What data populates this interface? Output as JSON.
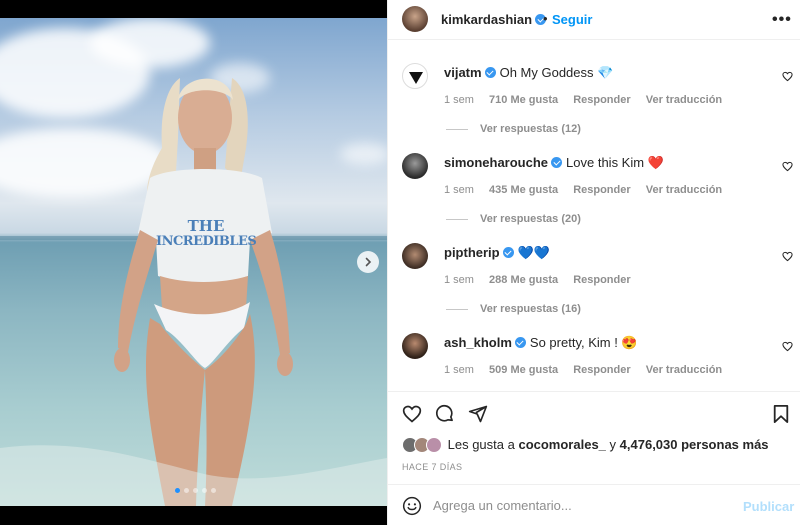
{
  "post": {
    "author": "kimkardashian",
    "separator": "•",
    "follow_label": "Seguir",
    "more_label": "•••",
    "media": {
      "shirt_text_line1": "THE",
      "shirt_text_line2": "INCREDIBLES",
      "slide_count": 5,
      "active_slide": 1
    }
  },
  "comments": [
    {
      "user": "vijatm",
      "text": "Oh My Goddess 💎",
      "time": "1 sem",
      "likes": "710 Me gusta",
      "reply": "Responder",
      "translate": "Ver traducción",
      "replies": "Ver respuestas (12)"
    },
    {
      "user": "simoneharouche",
      "text": "Love this Kim ❤️",
      "time": "1 sem",
      "likes": "435 Me gusta",
      "reply": "Responder",
      "translate": "Ver traducción",
      "replies": "Ver respuestas (20)"
    },
    {
      "user": "piptherip",
      "text": "💙💙",
      "time": "1 sem",
      "likes": "288 Me gusta",
      "reply": "Responder",
      "translate": "",
      "replies": "Ver respuestas (16)"
    },
    {
      "user": "ash_kholm",
      "text": "So pretty, Kim ! 😍",
      "time": "1 sem",
      "likes": "509 Me gusta",
      "reply": "Responder",
      "translate": "Ver traducción",
      "replies": ""
    }
  ],
  "likes": {
    "prefix": "Les gusta a",
    "first_liker": "cocomorales_",
    "connector": "y",
    "count_text": "4,476,030 personas más"
  },
  "date": "HACE 7 DÍAS",
  "composer": {
    "placeholder": "Agrega un comentario...",
    "publish_label": "Publicar"
  },
  "colors": {
    "accent": "#0095f6",
    "verified": "#3897f0",
    "muted": "#8e8e8e",
    "publish_disabled": "#b2dffc"
  },
  "icons": [
    "next-arrow-icon",
    "verified-icon",
    "more-options-icon",
    "heart-icon",
    "comment-icon",
    "share-icon",
    "bookmark-icon",
    "emoji-icon"
  ]
}
